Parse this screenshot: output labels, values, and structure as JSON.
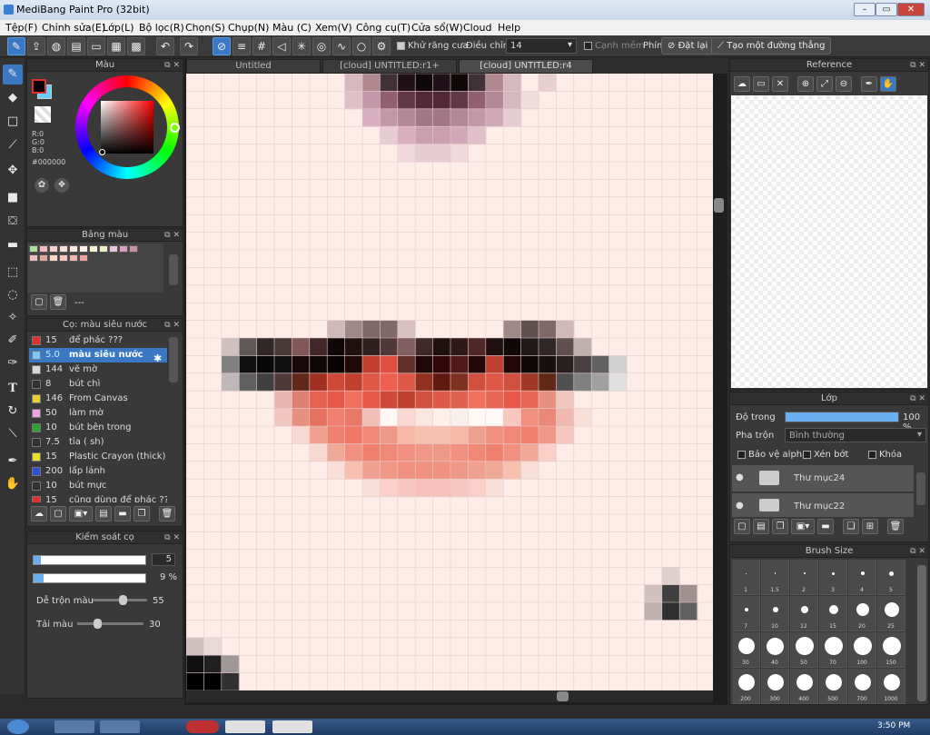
{
  "window": {
    "title": "MediBang Paint Pro (32bit)",
    "minimize": "–",
    "maximize": "▭",
    "close": "✕"
  },
  "menu": [
    "Tệp(F)",
    "Chỉnh sửa(E)",
    "Lớp(L)",
    "Bộ lọc(R)",
    "Chọn(S)",
    "Chụp(N)",
    "Màu (C)",
    "Xem(V)",
    "Công cụ(T)",
    "Cửa sổ(W)",
    "Cloud",
    "Help"
  ],
  "toolbar": {
    "antialias_label": "Khử răng cưa",
    "adjust_label": "Điều chỉnh",
    "adjust_value": "14",
    "soft_edge_label": "Cạnh mềm",
    "key_label": "Phím",
    "reset_label": "Đặt lại",
    "straight_line_label": "Tạo một đường thẳng"
  },
  "tabs": [
    "Untitled",
    "[cloud] UNTITLED:r1+",
    "[cloud] UNTITLED:r4"
  ],
  "color_panel": {
    "title": "Màu",
    "r": "R:0",
    "g": "G:0",
    "b": "B:0",
    "hex": "#000000"
  },
  "palette_panel": {
    "title": "Bảng màu",
    "name": "---"
  },
  "palette_colors": [
    "#a8e0a0",
    "#f4b8c0",
    "#f8d0d0",
    "#f8e0d8",
    "#fce8e0",
    "#fdf0e8",
    "#f8f0d0",
    "#f0f0c8",
    "#e8c8d8",
    "#d8a0c0",
    "#c890a8",
    "#f0c0c0",
    "#e0a898",
    "#fcd8c8",
    "#f8c8c0",
    "#f0b8b0",
    "#e8a8a0"
  ],
  "brush_panel": {
    "title": "Cọ: màu siêu nước",
    "brushes": [
      {
        "size": "15",
        "name": "để phác ???",
        "color": "#e03030"
      },
      {
        "size": "5.0",
        "name": "màu siêu nước",
        "color": "#7ec8f0"
      },
      {
        "size": "144",
        "name": "vẽ mờ",
        "color": "#d8d8d8"
      },
      {
        "size": "8",
        "name": "bút chì",
        "color": "#303030"
      },
      {
        "size": "146",
        "name": "From Canvas",
        "color": "#e8d030"
      },
      {
        "size": "50",
        "name": "làm mờ",
        "color": "#f0a0e0"
      },
      {
        "size": "10",
        "name": "bút bên trong",
        "color": "#30a030"
      },
      {
        "size": "7.5",
        "name": "tỉa ( sh)",
        "color": "#303030"
      },
      {
        "size": "15",
        "name": "Plastic Crayon (thick)",
        "color": "#e8e030"
      },
      {
        "size": "200",
        "name": "lấp lánh",
        "color": "#3050d0"
      },
      {
        "size": "10",
        "name": "bút mực",
        "color": "#303030"
      },
      {
        "size": "15",
        "name": "cũng dùng để phác ??",
        "color": "#e03030"
      }
    ]
  },
  "brush_control": {
    "title": "Kiểm soát cọ",
    "size_value": "5",
    "opacity_value": "9 %",
    "blend_label": "Dễ trộn màu",
    "blend_value": "55",
    "amount_label": "Tải màu",
    "amount_value": "30",
    "size_fraction": 0.03,
    "opacity_fraction": 0.09,
    "blend_fraction": 0.55,
    "amount_fraction": 0.3
  },
  "reference_panel": {
    "title": "Reference"
  },
  "layer_panel": {
    "title": "Lớp",
    "opacity_label": "Độ trong",
    "opacity_value": "100 %",
    "opacity_fraction": 1.0,
    "blend_label": "Pha trộn",
    "blend_value": "Bình thường",
    "protect_alpha": "Bảo vệ alpha",
    "clipping": "Xén bớt",
    "lock": "Khóa",
    "layers": [
      "Thư mục24",
      "Thư mục22"
    ]
  },
  "brush_size_panel": {
    "title": "Brush Size",
    "sizes": [
      "1",
      "1.5",
      "2",
      "3",
      "4",
      "5",
      "7",
      "10",
      "12",
      "15",
      "20",
      "25",
      "30",
      "40",
      "50",
      "70",
      "100",
      "150",
      "200",
      "300",
      "400",
      "500",
      "700",
      "1000"
    ]
  },
  "taskbar": {
    "time": "3:50 PM"
  }
}
